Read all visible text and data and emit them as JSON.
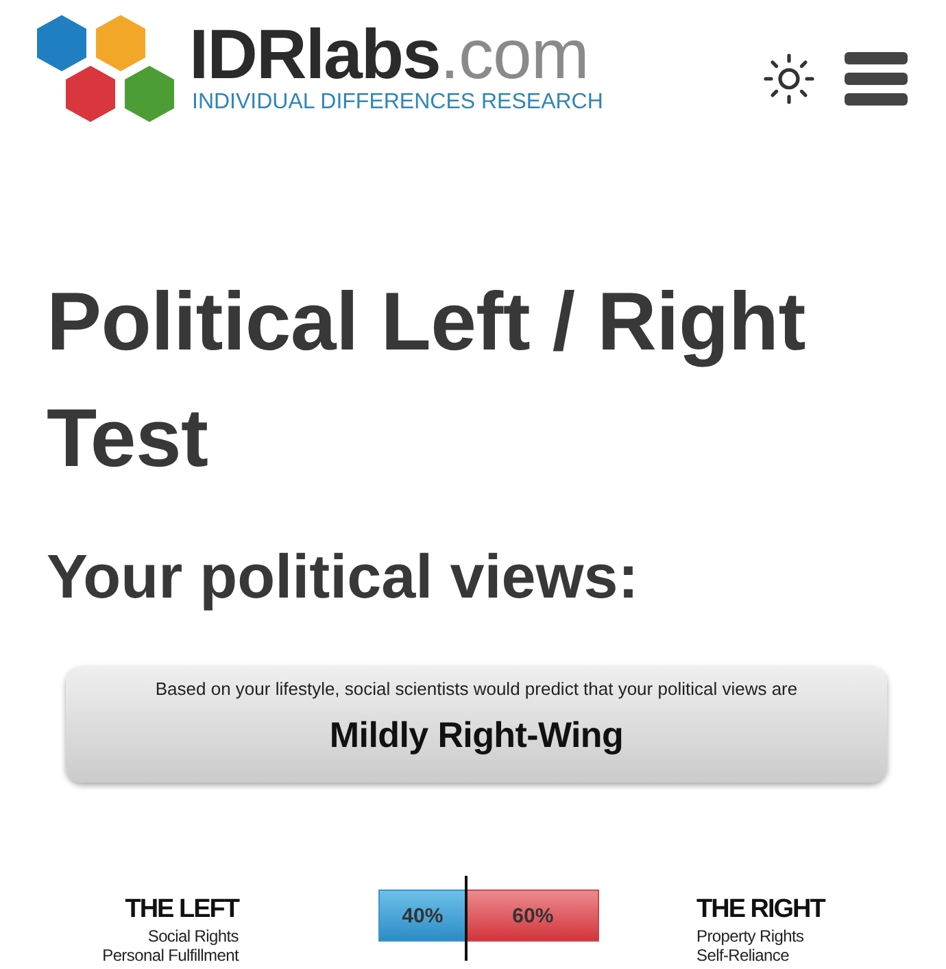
{
  "header": {
    "logo": {
      "wordmark": "**IDRlabs**.com",
      "tagline": "INDIVIDUAL DIFFERENCES RESEARCH"
    }
  },
  "title": "Political Left / Right Test",
  "section_heading": "Your political views:",
  "result": {
    "intro": "Based on your lifestyle, social scientists would predict that your political views are",
    "verdict": "Mildly Right-Wing"
  },
  "scale": {
    "left": {
      "heading": "THE LEFT",
      "values": [
        "Social Rights",
        "Personal Fulfillment"
      ]
    },
    "bar": {
      "level": 0.4,
      "left_label": "40%",
      "right_label": "60%"
    },
    "right": {
      "heading": "THE RIGHT",
      "values": [
        "Property Rights",
        "Self-Reliance"
      ]
    }
  }
}
